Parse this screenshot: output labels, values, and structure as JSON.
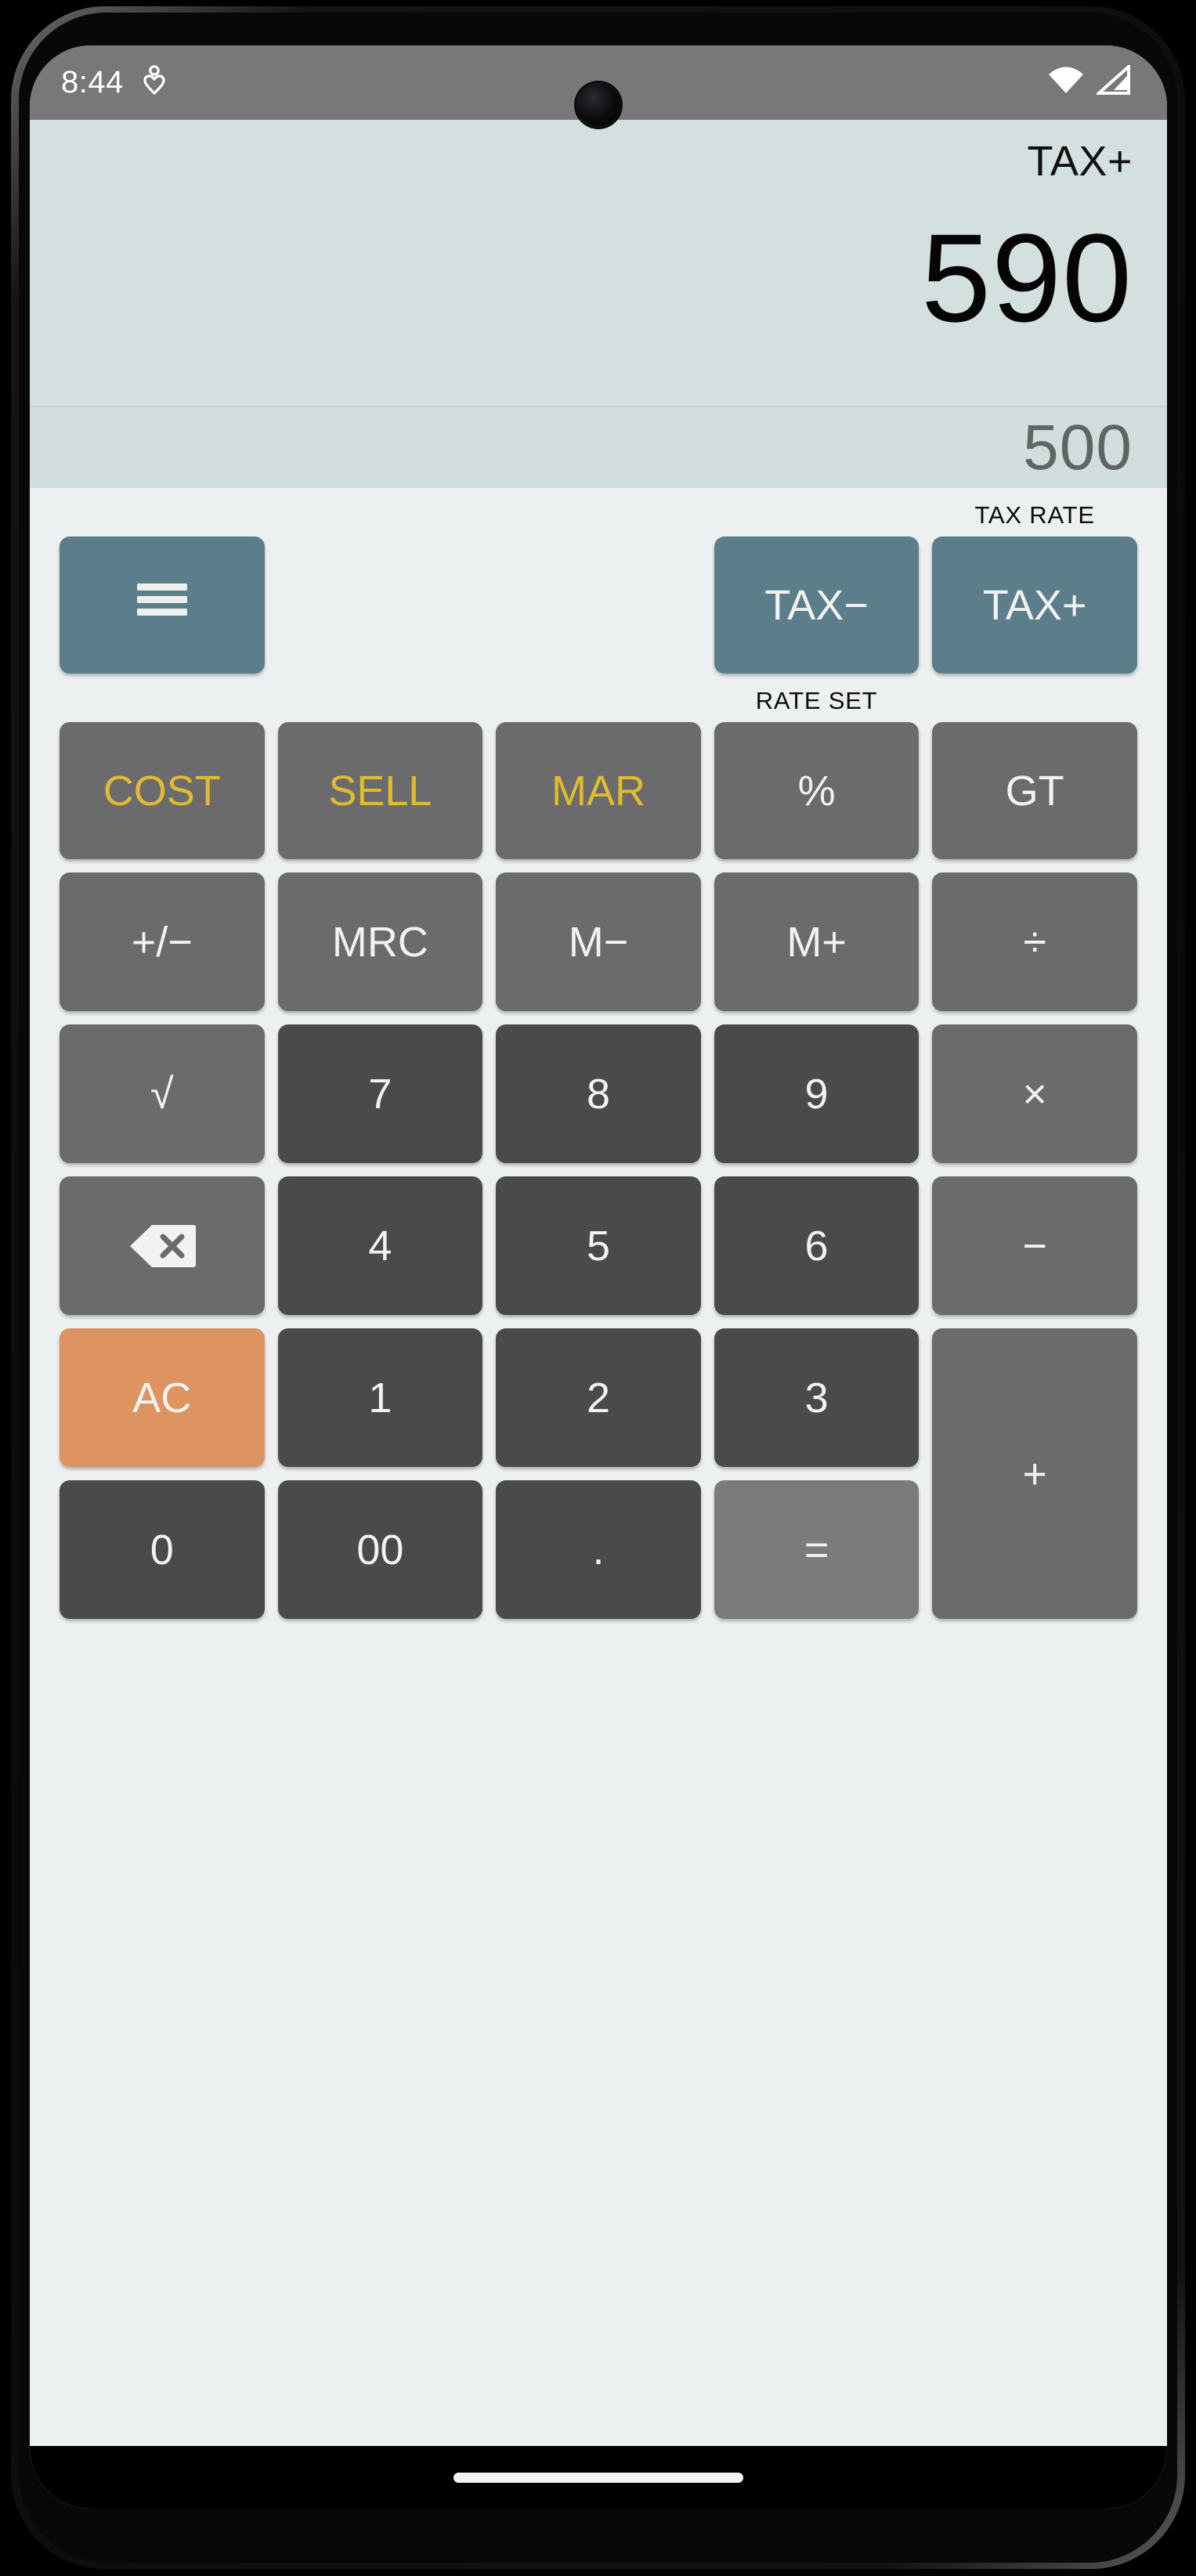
{
  "status_bar": {
    "time": "8:44",
    "icons": [
      "health-heart-icon",
      "wifi-icon",
      "cellular-signal-icon"
    ]
  },
  "display": {
    "mode_label": "TAX+",
    "main_value": "590",
    "sub_value": "500"
  },
  "labels": {
    "tax_rate": "TAX RATE",
    "rate_set": "RATE SET"
  },
  "colors": {
    "display_bg": "#d4e0df",
    "keypad_bg": "#edf0f1",
    "function_key": "#6b6b6e",
    "digit_key": "#4a4a4d",
    "teal_key": "#5b7e8a",
    "accent_key": "#dd9460",
    "equal_key": "#7b7b7e",
    "gold_text": "#e0bb2e",
    "statusbar_bg": "#78787b"
  },
  "keys": {
    "menu": "menu-hamburger-icon",
    "tax_minus": "TAX−",
    "tax_plus": "TAX+",
    "cost": "COST",
    "sell": "SELL",
    "mar": "MAR",
    "percent": "%",
    "gt": "GT",
    "sign": "+/−",
    "mrc": "MRC",
    "m_minus": "M−",
    "m_plus": "M+",
    "divide": "÷",
    "sqrt": "√",
    "d7": "7",
    "d8": "8",
    "d9": "9",
    "multiply": "×",
    "backspace": "backspace-icon",
    "d4": "4",
    "d5": "5",
    "d6": "6",
    "minus": "−",
    "ac": "AC",
    "d1": "1",
    "d2": "2",
    "d3": "3",
    "plus": "+",
    "d0": "0",
    "d00": "00",
    "dot": ".",
    "equals": "="
  }
}
